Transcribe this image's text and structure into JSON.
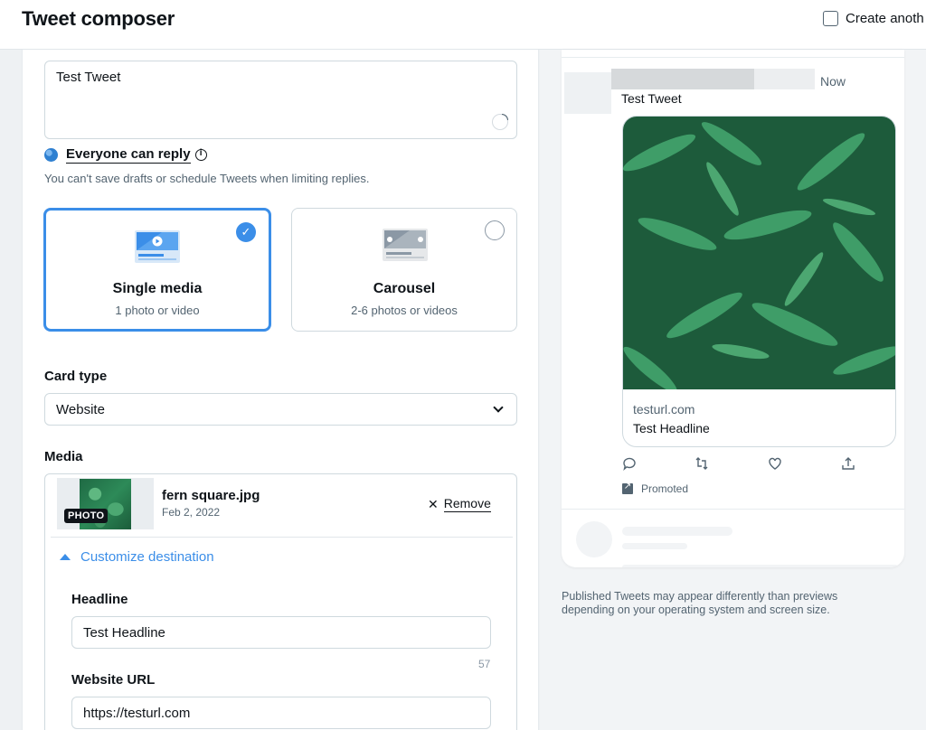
{
  "header": {
    "title": "Tweet composer",
    "create_another_label": "Create anoth"
  },
  "composer": {
    "tweet_text": "Test Tweet",
    "reply_setting": "Everyone can reply",
    "reply_note": "You can't save drafts or schedule Tweets when limiting replies.",
    "media_options": [
      {
        "title": "Single media",
        "subtitle": "1 photo or video",
        "selected": true
      },
      {
        "title": "Carousel",
        "subtitle": "2-6 photos or videos",
        "selected": false
      }
    ],
    "card_type_label": "Card type",
    "card_type_value": "Website",
    "media_label": "Media",
    "media_item": {
      "badge": "PHOTO",
      "file_name": "fern square.jpg",
      "date": "Feb 2, 2022",
      "remove_label": "Remove"
    },
    "customize_label": "Customize destination",
    "headline_label": "Headline",
    "headline_value": "Test Headline",
    "headline_char_count": "57",
    "website_url_label": "Website URL",
    "website_url_value": "https://testurl.com"
  },
  "preview": {
    "time": "Now",
    "tweet_text": "Test Tweet",
    "link_domain": "testurl.com",
    "link_headline": "Test Headline",
    "promoted_label": "Promoted",
    "note": "Published Tweets may appear differently than previews depending on your operating system and screen size."
  },
  "icons": {
    "reply_visibility": "globe-icon",
    "reply_info": "info-icon",
    "selected": "check-icon",
    "remove": "close-icon",
    "customize": "caret-up-icon",
    "card_type_dropdown": "chevron-down-icon",
    "actions": [
      "reply-icon",
      "retweet-icon",
      "like-icon",
      "share-icon"
    ]
  },
  "colors": {
    "accent": "#3b8ee8",
    "text": "#0f1419",
    "secondary_text": "#536471",
    "border": "#cfd9de"
  }
}
